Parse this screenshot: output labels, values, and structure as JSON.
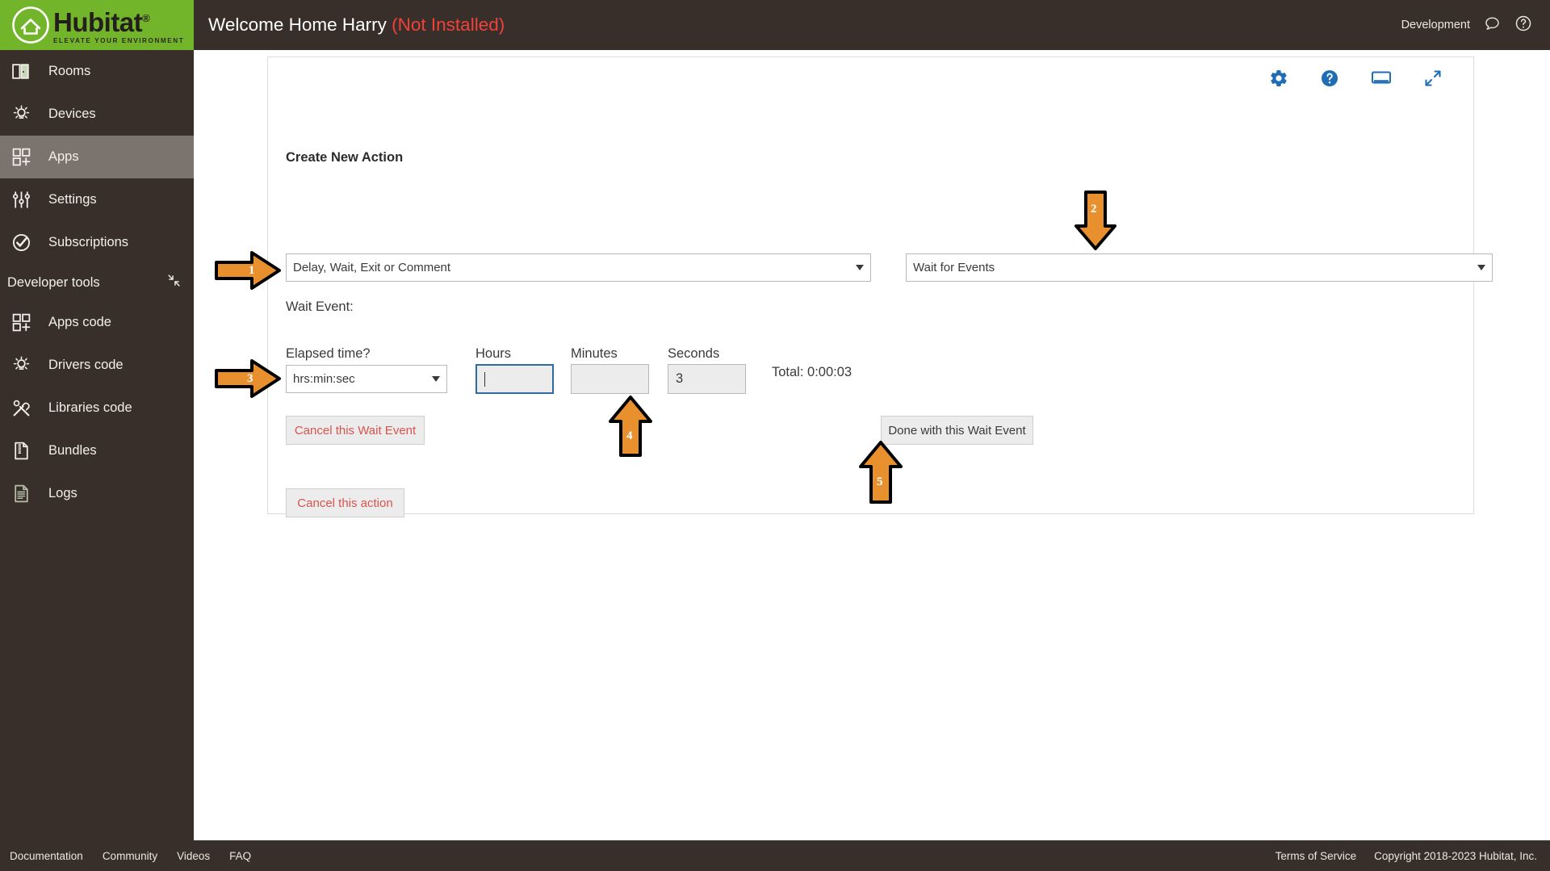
{
  "brand": {
    "name": "Hubitat",
    "registered": "®",
    "tagline": "ELEVATE YOUR ENVIRONMENT",
    "green": "#73b52a",
    "dark": "#382f2a"
  },
  "sidebar": {
    "items": [
      {
        "label": "Rooms",
        "icon": "rooms-icon",
        "active": false
      },
      {
        "label": "Devices",
        "icon": "devices-icon",
        "active": false
      },
      {
        "label": "Apps",
        "icon": "apps-icon",
        "active": true
      },
      {
        "label": "Settings",
        "icon": "settings-icon",
        "active": false
      },
      {
        "label": "Subscriptions",
        "icon": "subscriptions-icon",
        "active": false
      }
    ],
    "section": {
      "label": "Developer tools",
      "collapse_icon": "collapse-icon"
    },
    "dev_items": [
      {
        "label": "Apps code",
        "icon": "apps-code-icon"
      },
      {
        "label": "Drivers code",
        "icon": "drivers-code-icon"
      },
      {
        "label": "Libraries code",
        "icon": "libraries-code-icon"
      },
      {
        "label": "Bundles",
        "icon": "bundles-icon"
      },
      {
        "label": "Logs",
        "icon": "logs-icon"
      }
    ]
  },
  "topbar": {
    "title": "Welcome Home Harry",
    "status": "(Not Installed)",
    "status_color": "#f0413a",
    "environment": "Development",
    "chat_icon": "chat-icon",
    "help_icon": "help-circle-icon"
  },
  "card": {
    "icons": [
      {
        "name": "gear-icon"
      },
      {
        "name": "help-circle-icon"
      },
      {
        "name": "display-icon"
      },
      {
        "name": "expand-icon"
      }
    ],
    "accent": "#1f6db5",
    "section_title": "Create New Action",
    "action_type": {
      "value": "Delay, Wait, Exit or Comment",
      "caret": "chevron-down-icon"
    },
    "action_sub": {
      "value": "Wait for Events",
      "caret": "chevron-down-icon"
    },
    "wait_event_label": "Wait Event:",
    "elapsed": {
      "label": "Elapsed time?",
      "value": "hrs:min:sec",
      "caret": "chevron-down-icon"
    },
    "hours": {
      "label": "Hours",
      "value": "",
      "placeholder": "",
      "focused": true
    },
    "minutes": {
      "label": "Minutes",
      "value": "",
      "placeholder": "",
      "focused": false
    },
    "seconds": {
      "label": "Seconds",
      "value": "3",
      "placeholder": "",
      "focused": false
    },
    "total_text": "Total: 0:00:03",
    "buttons": {
      "cancel_wait": "Cancel this Wait Event",
      "done_wait": "Done with this Wait Event",
      "cancel_action": "Cancel this action"
    }
  },
  "annotations": {
    "color": "#e8902e",
    "arrows": [
      {
        "number": "1",
        "direction": "right"
      },
      {
        "number": "2",
        "direction": "down"
      },
      {
        "number": "3",
        "direction": "right"
      },
      {
        "number": "4",
        "direction": "up"
      },
      {
        "number": "5",
        "direction": "up"
      }
    ]
  },
  "footer": {
    "links": [
      "Documentation",
      "Community",
      "Videos",
      "FAQ"
    ],
    "terms": "Terms of Service",
    "copyright": "Copyright 2018-2023 Hubitat, Inc."
  }
}
